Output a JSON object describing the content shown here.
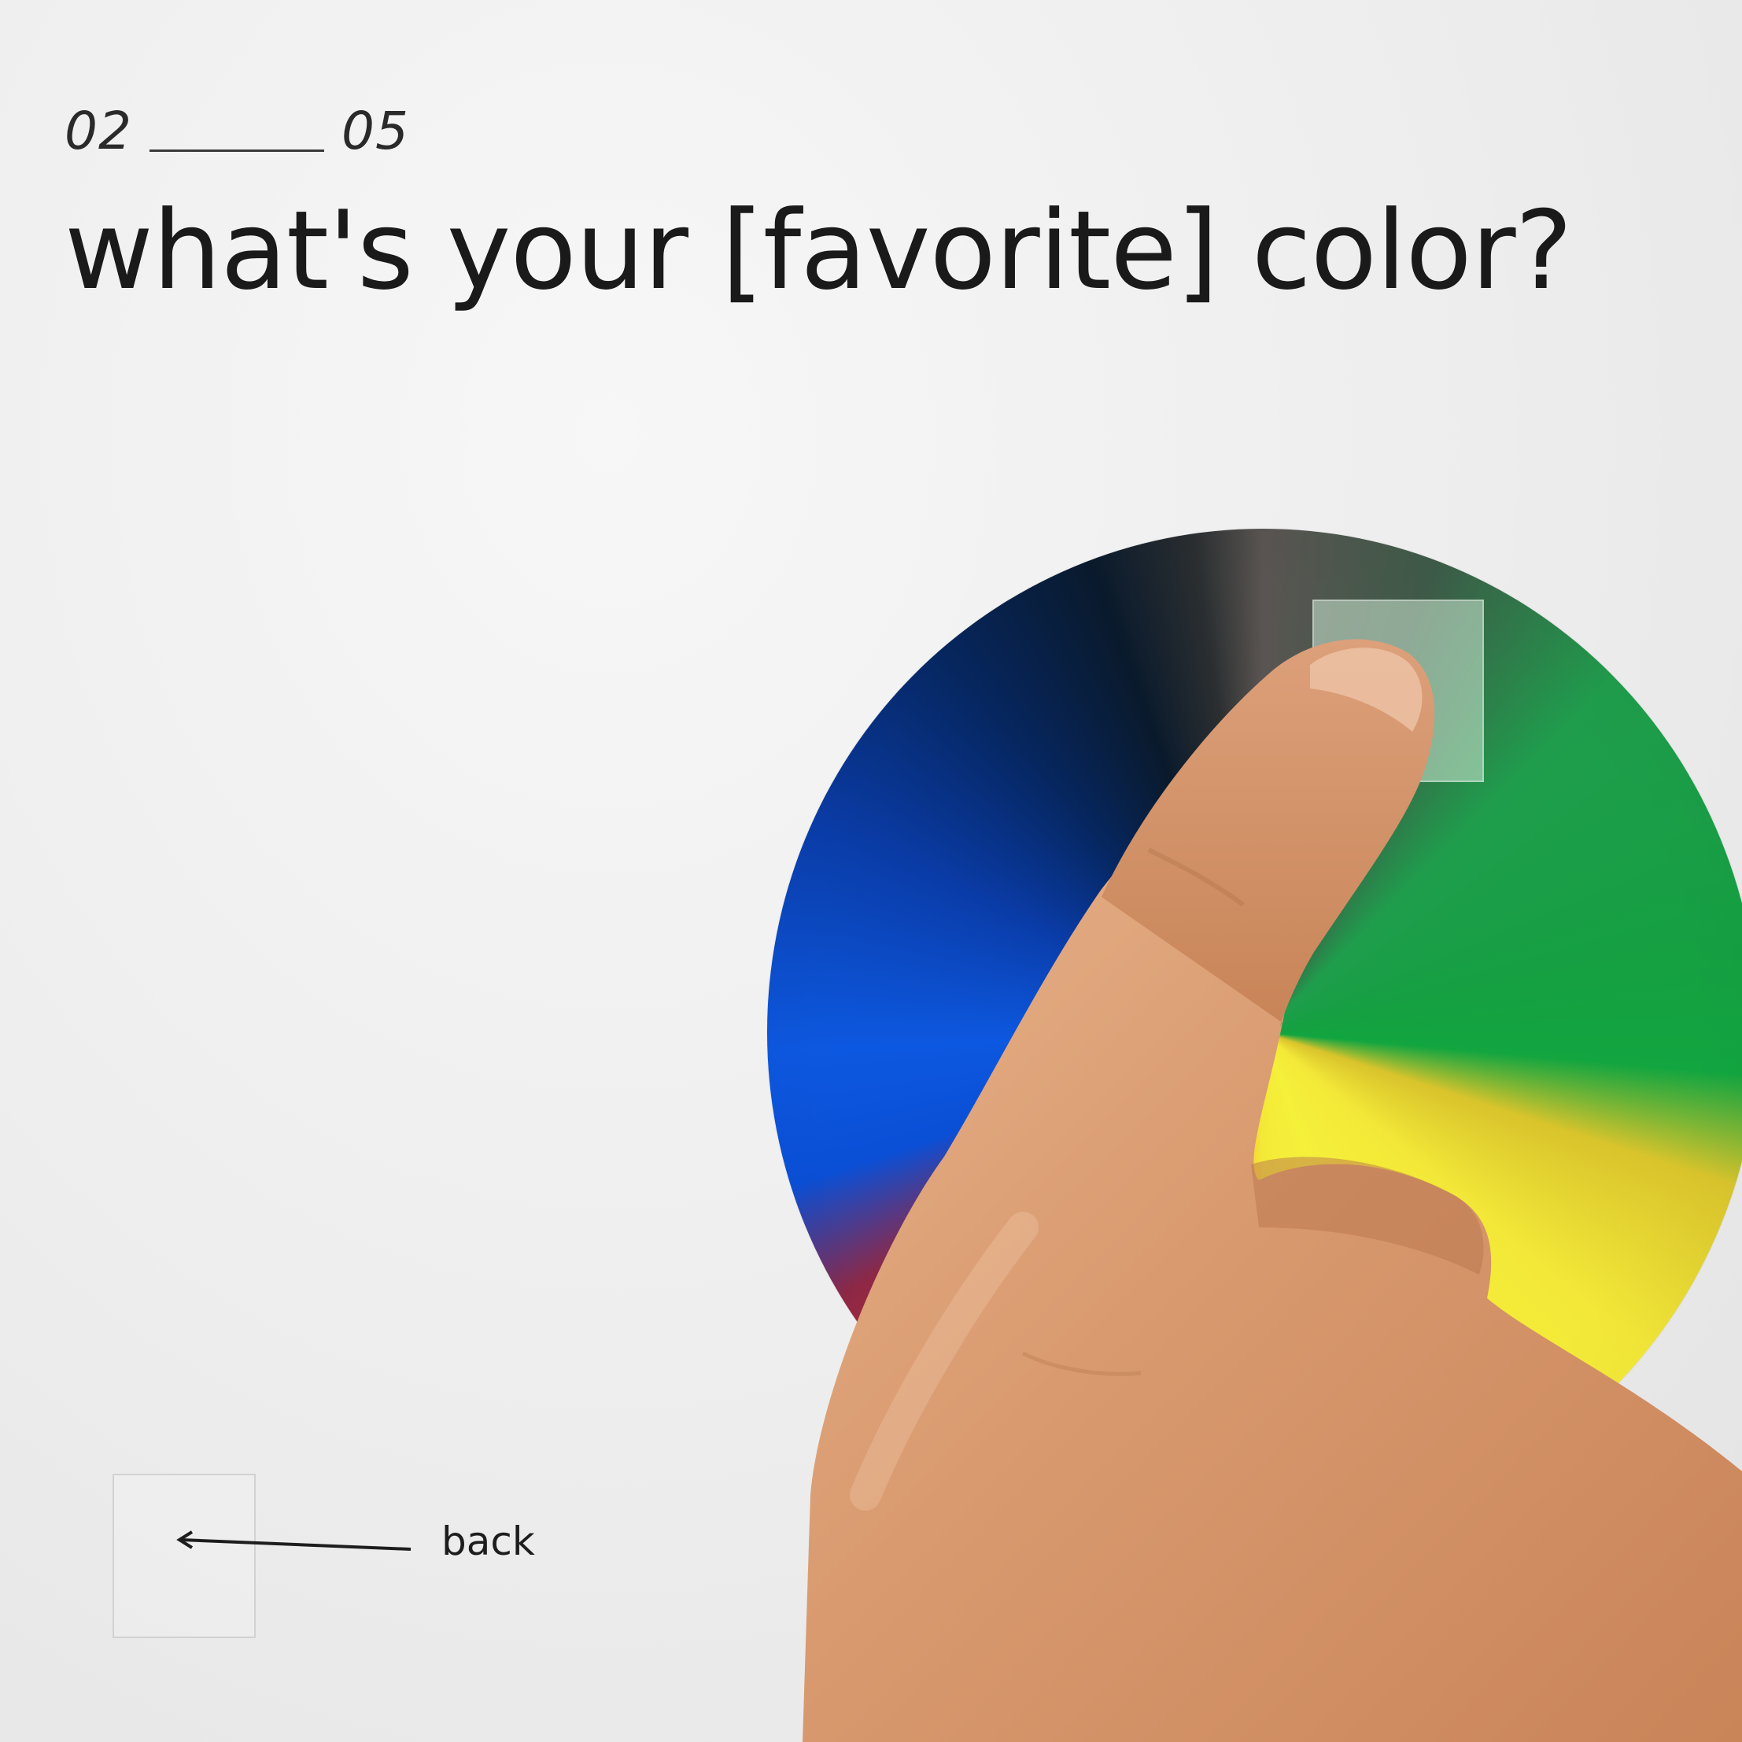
{
  "progress": {
    "current": "02",
    "total": "05"
  },
  "question": {
    "title": "what's your [favorite] color?"
  },
  "color_picker": {
    "type": "hue-wheel"
  },
  "navigation": {
    "back_label": "back",
    "back_icon": "arrow-left-icon"
  },
  "colors": {
    "background": "#ededed",
    "text": "#1a1a1a",
    "selector": "#d2ebd7"
  }
}
